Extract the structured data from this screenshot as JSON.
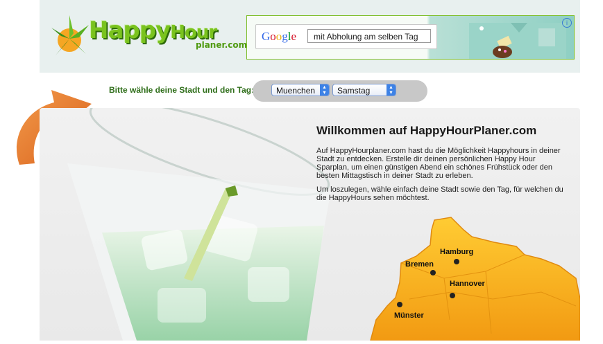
{
  "header": {
    "logo": {
      "word1": "Happy",
      "word2": "Hour",
      "sub": "planer.com"
    },
    "ad": {
      "brand": "Google",
      "query": "mit Abholung am selben Tag",
      "info_icon": "info-icon"
    }
  },
  "selector": {
    "prompt": "Bitte wähle deine Stadt und den Tag:",
    "city": "Muenchen",
    "day": "Samstag"
  },
  "main": {
    "title": "Willkommen auf HappyHourPlaner.com",
    "intro": "Auf HappyHourplaner.com hast du die Möglichkeit Happyhours in deiner Stadt zu entdecken. Erstelle dir deinen persönlichen Happy Hour Sparplan, um einen günstigen Abend ein schönes Frühstück oder den besten Mittagstisch in deiner Stadt zu erleben.",
    "instruction": "Um loszulegen, wähle einfach deine Stadt sowie den Tag, für welchen du die HappyHours sehen möchtest."
  },
  "map": {
    "cities": [
      "Hamburg",
      "Bremen",
      "Hannover",
      "Münster"
    ]
  },
  "colors": {
    "accent_green": "#7ac31e",
    "prompt_green": "#2f6e1a",
    "map_orange": "#f5a623",
    "arrow_orange": "#e8782a",
    "header_bg": "#e8f0ef"
  }
}
